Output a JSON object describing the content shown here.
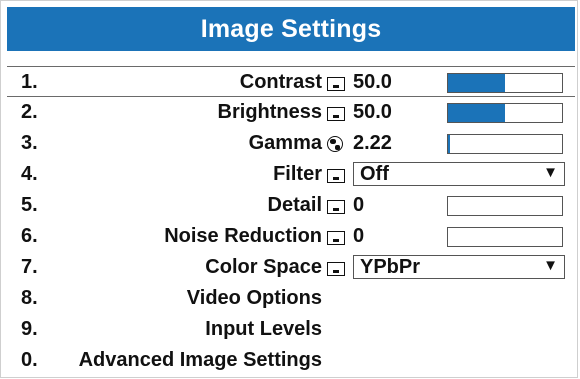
{
  "title": "Image Settings",
  "colors": {
    "title_bg": "#1b73b8",
    "bar_fill": "#1b73b8"
  },
  "items": [
    {
      "num": "1.",
      "label": "Contrast",
      "icon": "slider-icon",
      "value": "50.0",
      "bar_fraction": 0.5
    },
    {
      "num": "2.",
      "label": "Brightness",
      "icon": "slider-icon",
      "value": "50.0",
      "bar_fraction": 0.5
    },
    {
      "num": "3.",
      "label": "Gamma",
      "icon": "globe-icon",
      "value": "2.22",
      "bar_fraction": 0.02
    },
    {
      "num": "4.",
      "label": "Filter",
      "icon": "slider-icon",
      "select_value": "Off"
    },
    {
      "num": "5.",
      "label": "Detail",
      "icon": "slider-icon",
      "value": "0",
      "bar_fraction": 0
    },
    {
      "num": "6.",
      "label": "Noise Reduction",
      "icon": "slider-icon",
      "value": "0",
      "bar_fraction": 0
    },
    {
      "num": "7.",
      "label": "Color Space",
      "icon": "slider-icon",
      "select_value": "YPbPr"
    },
    {
      "num": "8.",
      "label": "Video Options"
    },
    {
      "num": "9.",
      "label": "Input Levels"
    },
    {
      "num": "0.",
      "label": "Advanced Image Settings"
    }
  ],
  "dropdown_arrow": "▼"
}
